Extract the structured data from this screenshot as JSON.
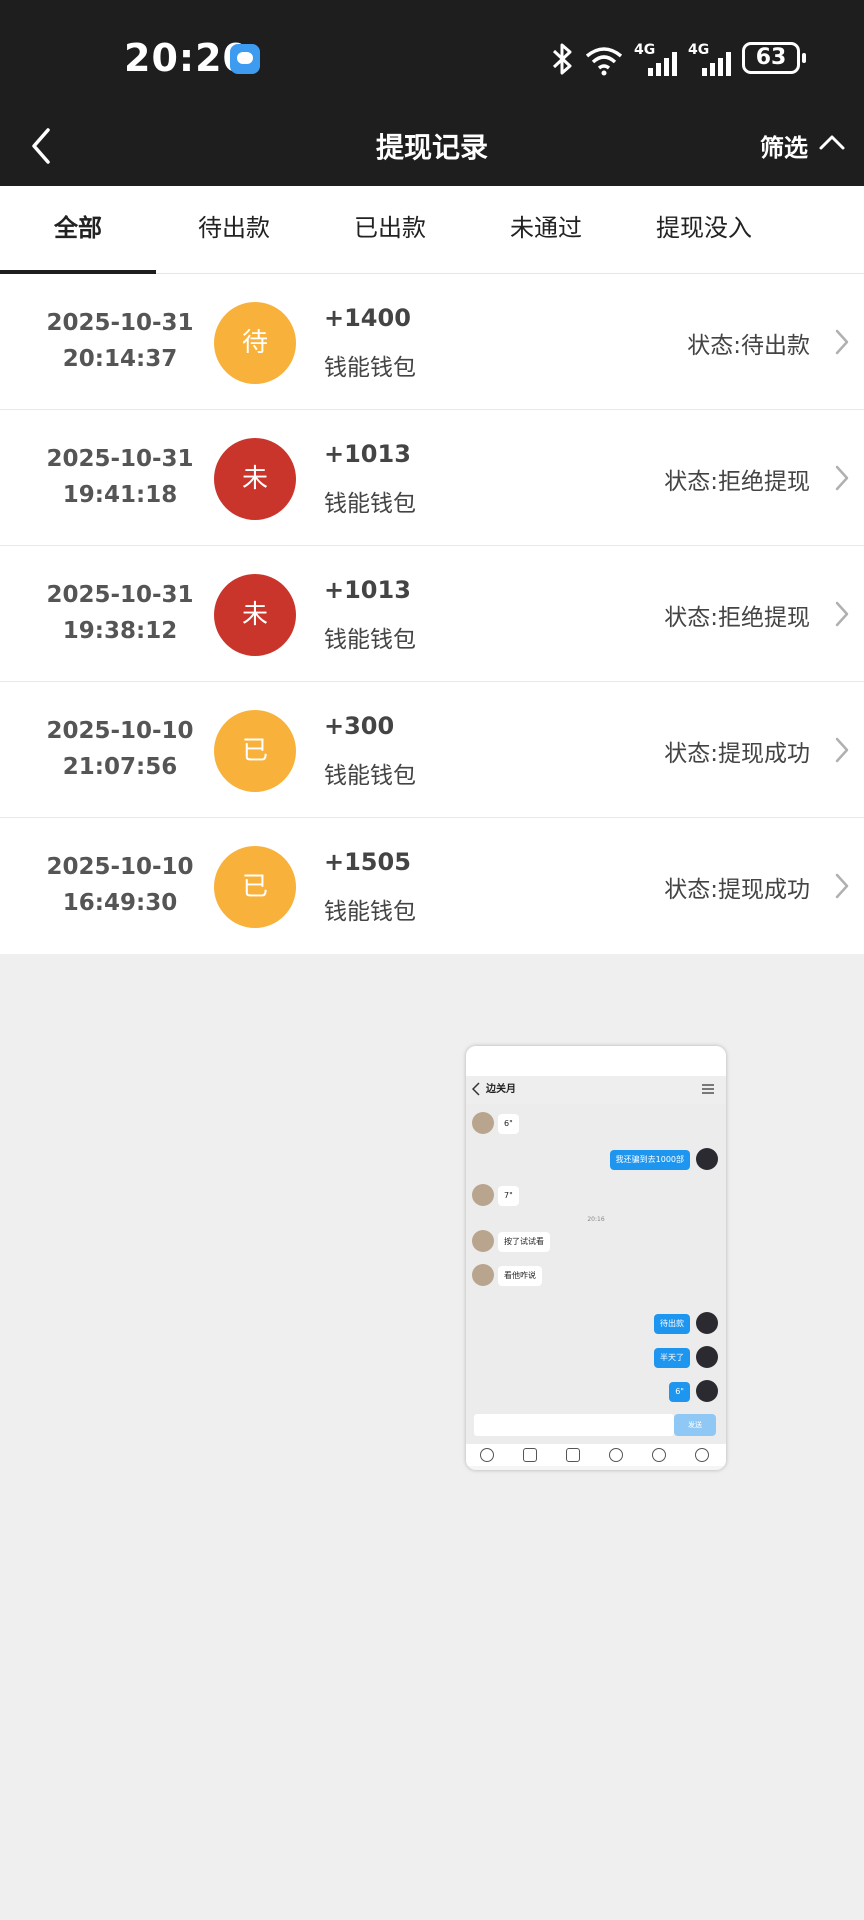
{
  "status_bar": {
    "time": "20:20",
    "network_1": "4G",
    "network_2": "4G",
    "battery": "63"
  },
  "header": {
    "title": "提现记录",
    "filter_label": "筛选"
  },
  "tabs": [
    {
      "label": "全部",
      "active": true
    },
    {
      "label": "待出款",
      "active": false
    },
    {
      "label": "已出款",
      "active": false
    },
    {
      "label": "未通过",
      "active": false
    },
    {
      "label": "提现没入",
      "active": false
    }
  ],
  "records": [
    {
      "date": "2025-10-31",
      "time": "20:14:37",
      "badge": "待",
      "badge_color": "#f8b13a",
      "amount": "+1400",
      "wallet": "钱能钱包",
      "status": "状态:待出款"
    },
    {
      "date": "2025-10-31",
      "time": "19:41:18",
      "badge": "未",
      "badge_color": "#c9352a",
      "amount": "+1013",
      "wallet": "钱能钱包",
      "status": "状态:拒绝提现"
    },
    {
      "date": "2025-10-31",
      "time": "19:38:12",
      "badge": "未",
      "badge_color": "#c9352a",
      "amount": "+1013",
      "wallet": "钱能钱包",
      "status": "状态:拒绝提现"
    },
    {
      "date": "2025-10-10",
      "time": "21:07:56",
      "badge": "已",
      "badge_color": "#f8b13a",
      "amount": "+300",
      "wallet": "钱能钱包",
      "status": "状态:提现成功"
    },
    {
      "date": "2025-10-10",
      "time": "16:49:30",
      "badge": "已",
      "badge_color": "#f8b13a",
      "amount": "+1505",
      "wallet": "钱能钱包",
      "status": "状态:提现成功"
    }
  ],
  "chat_thumbnail": {
    "contact_name": "边关月",
    "messages": [
      {
        "side": "left",
        "text": "6\""
      },
      {
        "side": "right",
        "text": "我还骗到去1000部"
      },
      {
        "side": "left",
        "text": "7\""
      },
      {
        "side": "center",
        "text": "20:16"
      },
      {
        "side": "left",
        "text": "按了试试看"
      },
      {
        "side": "left",
        "text": "看他咋说"
      },
      {
        "side": "right",
        "text": "待出款"
      },
      {
        "side": "right",
        "text": "半天了"
      },
      {
        "side": "right",
        "text": "6\""
      }
    ],
    "send_label": "发送"
  }
}
